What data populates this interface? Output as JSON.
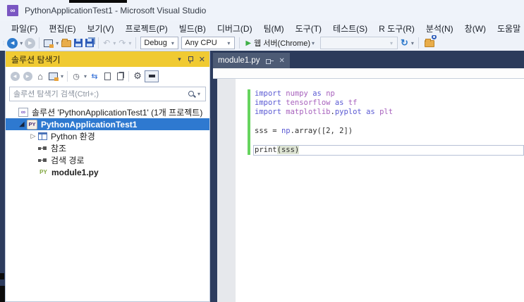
{
  "window": {
    "title": "PythonApplicationTest1 - Microsoft Visual Studio"
  },
  "menu": {
    "items": [
      "파일(F)",
      "편집(E)",
      "보기(V)",
      "프로젝트(P)",
      "빌드(B)",
      "디버그(D)",
      "팀(M)",
      "도구(T)",
      "테스트(S)",
      "R 도구(R)",
      "분석(N)",
      "창(W)",
      "도움말"
    ]
  },
  "toolbar": {
    "debug_config": "Debug",
    "platform": "Any CPU",
    "run_label": "웹 서버(Chrome)"
  },
  "solution_explorer": {
    "title": "솔루션 탐색기",
    "search_placeholder": "솔루션 탐색기 검색(Ctrl+;)",
    "tree": [
      {
        "label": "솔루션 'PythonApplicationTest1' (1개 프로젝트)"
      },
      {
        "label": "PythonApplicationTest1",
        "selected": true
      },
      {
        "label": "Python 환경"
      },
      {
        "label": "참조"
      },
      {
        "label": "검색 경로"
      },
      {
        "label": "module1.py",
        "bold": true
      }
    ]
  },
  "editor": {
    "tab": "module1.py",
    "code": {
      "lines": [
        {
          "tokens": [
            {
              "t": "import",
              "y": "kw"
            },
            {
              "t": " ",
              "y": "pl"
            },
            {
              "t": "numpy",
              "y": "mod"
            },
            {
              "t": " ",
              "y": "pl"
            },
            {
              "t": "as",
              "y": "kw"
            },
            {
              "t": " ",
              "y": "pl"
            },
            {
              "t": "np",
              "y": "mod"
            }
          ]
        },
        {
          "tokens": [
            {
              "t": "import",
              "y": "kw"
            },
            {
              "t": " ",
              "y": "pl"
            },
            {
              "t": "tensorflow",
              "y": "mod"
            },
            {
              "t": " ",
              "y": "pl"
            },
            {
              "t": "as",
              "y": "kw"
            },
            {
              "t": " ",
              "y": "pl"
            },
            {
              "t": "tf",
              "y": "mod"
            }
          ]
        },
        {
          "tokens": [
            {
              "t": "import",
              "y": "kw"
            },
            {
              "t": " ",
              "y": "pl"
            },
            {
              "t": "matplotlib",
              "y": "mod"
            },
            {
              "t": ".",
              "y": "pl"
            },
            {
              "t": "pyplot",
              "y": "kw"
            },
            {
              "t": " ",
              "y": "pl"
            },
            {
              "t": "as",
              "y": "kw"
            },
            {
              "t": " ",
              "y": "pl"
            },
            {
              "t": "plt",
              "y": "mod"
            }
          ]
        },
        {
          "tokens": []
        },
        {
          "tokens": [
            {
              "t": "sss = ",
              "y": "pl"
            },
            {
              "t": "np",
              "y": "kw"
            },
            {
              "t": ".array([2, 2])",
              "y": "pl"
            }
          ]
        },
        {
          "tokens": []
        },
        {
          "caret": true,
          "tokens": [
            {
              "t": "print",
              "y": "pl"
            },
            {
              "t": "(",
              "y": "hl"
            },
            {
              "t": "sss",
              "y": "hl"
            },
            {
              "t": ")",
              "y": "hl"
            }
          ]
        }
      ]
    }
  },
  "colors": {
    "chrome_bg": "#eef2f9",
    "navy_frame": "#2d3c5e",
    "active_toolwindow_gold": "#f0ca32",
    "selection_blue": "#2e79d0",
    "tab_inactive_focus": "#4d5b75",
    "keyword_violet": "#5b5ad3",
    "module_purple": "#a862bd",
    "change_bar_green": "#66d45e",
    "vs_logo_purple": "#7a56c2",
    "run_green": "#3faf46"
  }
}
